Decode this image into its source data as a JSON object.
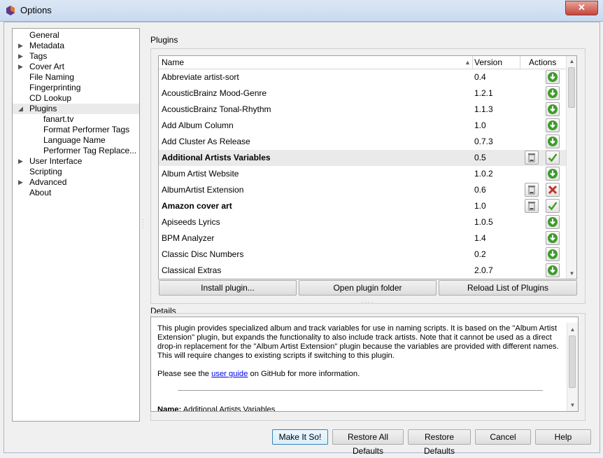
{
  "window": {
    "title": "Options",
    "close_glyph": "✕"
  },
  "sidebar": {
    "items": [
      {
        "label": "General",
        "level": 0,
        "arrow": ""
      },
      {
        "label": "Metadata",
        "level": 0,
        "arrow": "▶"
      },
      {
        "label": "Tags",
        "level": 0,
        "arrow": "▶"
      },
      {
        "label": "Cover Art",
        "level": 0,
        "arrow": "▶"
      },
      {
        "label": "File Naming",
        "level": 0,
        "arrow": ""
      },
      {
        "label": "Fingerprinting",
        "level": 0,
        "arrow": ""
      },
      {
        "label": "CD Lookup",
        "level": 0,
        "arrow": ""
      },
      {
        "label": "Plugins",
        "level": 0,
        "arrow": "◢",
        "selected": true
      },
      {
        "label": "fanart.tv",
        "level": 1,
        "arrow": ""
      },
      {
        "label": "Format Performer Tags",
        "level": 1,
        "arrow": ""
      },
      {
        "label": "Language Name",
        "level": 1,
        "arrow": ""
      },
      {
        "label": "Performer Tag Replace...",
        "level": 1,
        "arrow": ""
      },
      {
        "label": "User Interface",
        "level": 0,
        "arrow": "▶"
      },
      {
        "label": "Scripting",
        "level": 0,
        "arrow": ""
      },
      {
        "label": "Advanced",
        "level": 0,
        "arrow": "▶"
      },
      {
        "label": "About",
        "level": 0,
        "arrow": ""
      }
    ]
  },
  "plugins": {
    "group_label": "Plugins",
    "columns": {
      "name": "Name",
      "version": "Version",
      "actions": "Actions",
      "sort_glyph": "▲"
    },
    "rows": [
      {
        "name": "Abbreviate artist-sort",
        "version": "0.4",
        "bold": false,
        "state": "available"
      },
      {
        "name": "AcousticBrainz Mood-Genre",
        "version": "1.2.1",
        "bold": false,
        "state": "available"
      },
      {
        "name": "AcousticBrainz Tonal-Rhythm",
        "version": "1.1.3",
        "bold": false,
        "state": "available"
      },
      {
        "name": "Add Album Column",
        "version": "1.0",
        "bold": false,
        "state": "available"
      },
      {
        "name": "Add Cluster As Release",
        "version": "0.7.3",
        "bold": false,
        "state": "available"
      },
      {
        "name": "Additional Artists Variables",
        "version": "0.5",
        "bold": true,
        "state": "enabled",
        "selected": true
      },
      {
        "name": "Album Artist Website",
        "version": "1.0.2",
        "bold": false,
        "state": "available"
      },
      {
        "name": "AlbumArtist Extension",
        "version": "0.6",
        "bold": false,
        "state": "disabled"
      },
      {
        "name": "Amazon cover art",
        "version": "1.0",
        "bold": true,
        "state": "enabled"
      },
      {
        "name": "Apiseeds Lyrics",
        "version": "1.0.5",
        "bold": false,
        "state": "available"
      },
      {
        "name": "BPM Analyzer",
        "version": "1.4",
        "bold": false,
        "state": "available"
      },
      {
        "name": "Classic Disc Numbers",
        "version": "0.2",
        "bold": false,
        "state": "available"
      },
      {
        "name": "Classical Extras",
        "version": "2.0.7",
        "bold": false,
        "state": "available"
      }
    ],
    "buttons": {
      "install": "Install plugin...",
      "open_folder": "Open plugin folder",
      "reload": "Reload List of Plugins"
    }
  },
  "details": {
    "group_label": "Details",
    "paragraph1": "This plugin provides specialized album and track variables for use in naming scripts. It is based on the \"Album Artist Extension\" plugin, but expands the functionality to also include track artists. Note that it cannot be used as a direct drop-in replacement for the \"Album Artist Extension\" plugin because the variables are provided with different names. This will require changes to existing scripts if switching to this plugin.",
    "see_prefix": "Please see the ",
    "link_text": "user guide",
    "see_suffix": " on GitHub for more information.",
    "name_label": "Name:",
    "name_value": " Additional Artists Variables"
  },
  "footer": {
    "make_it_so": "Make It So!",
    "restore_all": "Restore All Defaults",
    "restore": "Restore Defaults",
    "cancel": "Cancel",
    "help": "Help"
  },
  "colors": {
    "install_green": "#3f9b2c",
    "check_green": "#4a9a2c",
    "cross_red": "#c0322a"
  }
}
